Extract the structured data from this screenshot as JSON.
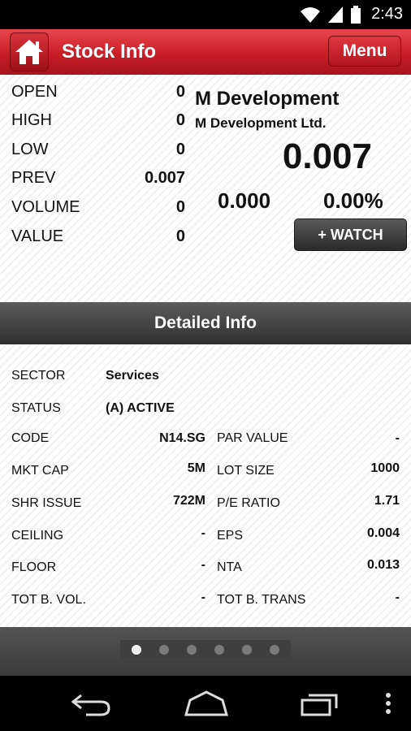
{
  "status_bar": {
    "time": "2:43",
    "icons": [
      "wifi-icon",
      "signal-icon",
      "battery-icon"
    ]
  },
  "header": {
    "title": "Stock Info",
    "menu_label": "Menu"
  },
  "quote": {
    "rows": [
      {
        "label": "OPEN",
        "value": "0"
      },
      {
        "label": "HIGH",
        "value": "0"
      },
      {
        "label": "LOW",
        "value": "0"
      },
      {
        "label": "PREV",
        "value": "0.007"
      },
      {
        "label": "VOLUME",
        "value": "0"
      },
      {
        "label": "VALUE",
        "value": "0"
      }
    ],
    "company_short": "M Development",
    "company_full": "M Development Ltd.",
    "price": "0.007",
    "change": "0.000",
    "change_pct": "0.00%",
    "watch_label": "+ WATCH"
  },
  "detail": {
    "title": "Detailed Info",
    "sector_label": "SECTOR",
    "sector_value": "Services",
    "status_label": "STATUS",
    "status_value": "(A) ACTIVE",
    "left": [
      {
        "label": "CODE",
        "value": "N14.SG"
      },
      {
        "label": "MKT CAP",
        "value": "5M"
      },
      {
        "label": "SHR ISSUE",
        "value": "722M"
      },
      {
        "label": "CEILING",
        "value": "-"
      },
      {
        "label": "FLOOR",
        "value": "-"
      },
      {
        "label": "TOT B. VOL.",
        "value": "-"
      }
    ],
    "right": [
      {
        "label": "PAR VALUE",
        "value": "-"
      },
      {
        "label": "LOT SIZE",
        "value": "1000"
      },
      {
        "label": "P/E RATIO",
        "value": "1.71"
      },
      {
        "label": "EPS",
        "value": "0.004"
      },
      {
        "label": "NTA",
        "value": "0.013"
      },
      {
        "label": "TOT B. TRANS",
        "value": "-"
      }
    ]
  },
  "pager": {
    "page_count": 6,
    "active_index": 0
  },
  "colors": {
    "brand_red": "#c81d27",
    "dark_bar": "#3a3a3a"
  }
}
